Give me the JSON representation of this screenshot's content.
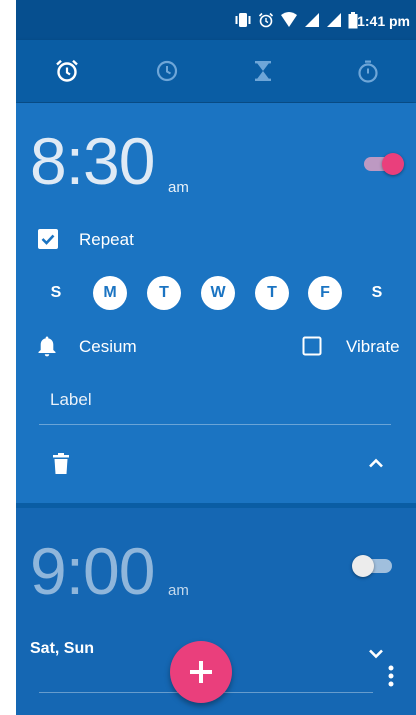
{
  "status_bar": {
    "time": "1:41 pm",
    "icons": [
      "vibrate-icon",
      "alarm-status-icon",
      "wifi-icon",
      "signal-icon",
      "signal-icon",
      "battery-icon"
    ]
  },
  "tabs": [
    {
      "name": "alarm-icon",
      "active": true
    },
    {
      "name": "clock-icon",
      "active": false
    },
    {
      "name": "timer-icon",
      "active": false
    },
    {
      "name": "stopwatch-icon",
      "active": false
    }
  ],
  "alarm1": {
    "time": "8:30",
    "ampm": "am",
    "enabled": true,
    "repeat_label": "Repeat",
    "repeat_checked": true,
    "days": [
      {
        "letter": "S",
        "selected": false
      },
      {
        "letter": "M",
        "selected": true
      },
      {
        "letter": "T",
        "selected": true
      },
      {
        "letter": "W",
        "selected": true
      },
      {
        "letter": "T",
        "selected": true
      },
      {
        "letter": "F",
        "selected": true
      },
      {
        "letter": "S",
        "selected": false
      }
    ],
    "ringtone": "Cesium",
    "vibrate_label": "Vibrate",
    "vibrate_checked": false,
    "label_placeholder": "Label"
  },
  "alarm2": {
    "time": "9:00",
    "ampm": "am",
    "enabled": false,
    "days_summary": "Sat, Sun"
  },
  "colors": {
    "primary": "#0a5da4",
    "card_expanded": "#1b74c2",
    "accent": "#ea3f7c"
  }
}
